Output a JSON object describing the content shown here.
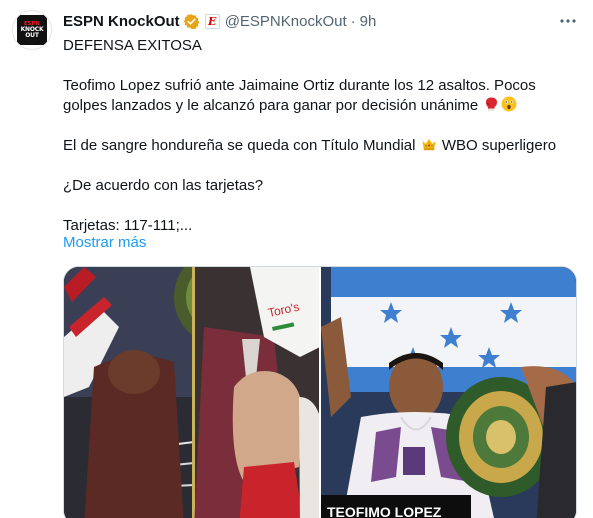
{
  "author": {
    "display_name": "ESPN KnockOut",
    "handle": "@ESPNKnockOut",
    "separator": "·",
    "time": "9h",
    "avatar_text": [
      "ESPN",
      "KNOCK",
      "OUT"
    ],
    "brand_badge_letter": "E",
    "verified_color": "#e8a317"
  },
  "tweet": {
    "line1": "DEFENSA EXITOSA",
    "paragraph2_text": "Teofimo Lopez sufrió ante Jaimaine Ortiz durante los 12 asaltos. Pocos golpes lanzados y le alcanzó para ganar por decisión unánime",
    "paragraph2_emojis": [
      "boxing-glove-emoji",
      "astonished-face-emoji"
    ],
    "paragraph3_before": "El de sangre hondureña se queda con Título Mundial",
    "paragraph3_emoji": "crown-emoji",
    "paragraph3_after": "WBO superligero",
    "paragraph4": "¿De acuerdo con las tarjetas?",
    "paragraph5": "Tarjetas: 117-111;...",
    "show_more": "Mostrar más"
  },
  "media": {
    "left_photo": "boxer-celebration-photo",
    "right_photo": "champion-with-belt-photo",
    "caption": "TEOFIMO LOPEZ",
    "sign_text": "Toro's"
  },
  "colors": {
    "link": "#1d9bf0",
    "secondary": "#536471",
    "text": "#0f1419"
  },
  "icons": {
    "more": "more-horizontal-icon",
    "verified": "verified-badge-icon"
  }
}
